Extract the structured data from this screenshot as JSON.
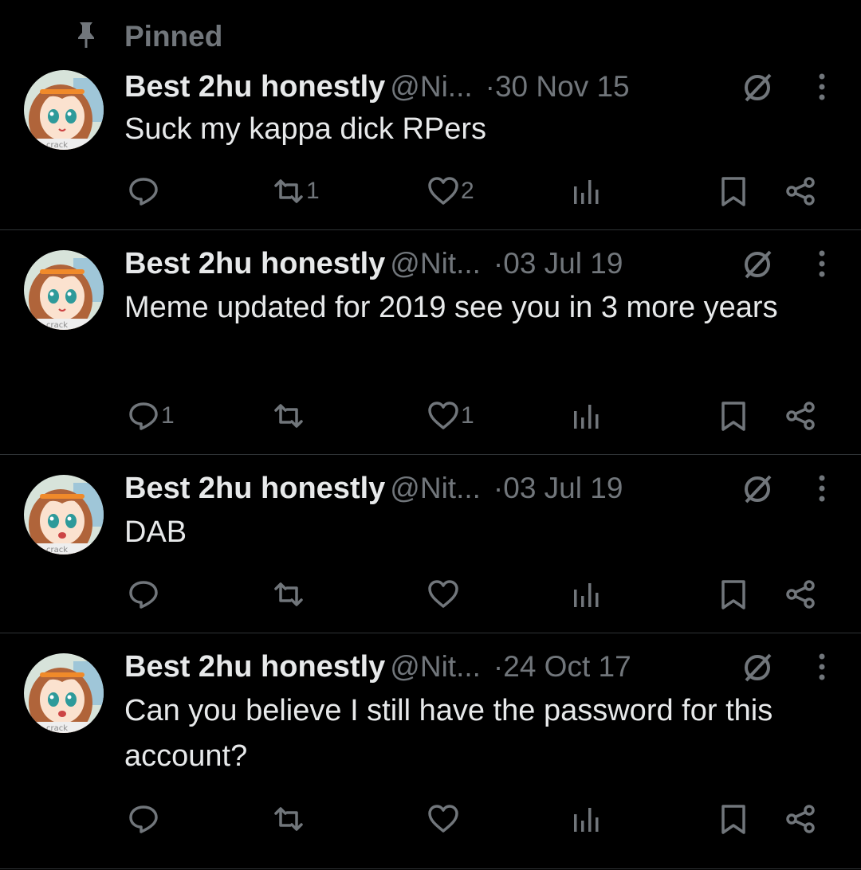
{
  "pinned_label": "Pinned",
  "colors": {
    "background": "#000000",
    "text_primary": "#e7e9ea",
    "text_secondary": "#71767b",
    "divider": "#2f3336"
  },
  "tweets": [
    {
      "display_name": "Best 2hu honestly",
      "handle": "@Ni...",
      "separator": "·",
      "date": "30 Nov 15",
      "text": "Suck my kappa dick RPers",
      "replies": "",
      "retweets": "1",
      "likes": "2"
    },
    {
      "display_name": "Best 2hu honestly",
      "handle": "@Nit...",
      "separator": "·",
      "date": "03 Jul 19",
      "text": "Meme updated for 2019 see you in 3 more years",
      "replies": "1",
      "retweets": "",
      "likes": "1"
    },
    {
      "display_name": "Best 2hu honestly",
      "handle": "@Nit...",
      "separator": "·",
      "date": "03 Jul 19",
      "text": "DAB",
      "replies": "",
      "retweets": "",
      "likes": ""
    },
    {
      "display_name": "Best 2hu honestly",
      "handle": "@Nit...",
      "separator": "·",
      "date": "24 Oct 17",
      "text": "Can you believe I still have the password for this account?",
      "replies": "",
      "retweets": "",
      "likes": ""
    }
  ],
  "icons": {
    "pin": "pin-icon",
    "reply": "reply-icon",
    "retweet": "retweet-icon",
    "like": "heart-icon",
    "views": "views-icon",
    "bookmark": "bookmark-icon",
    "share": "share-icon",
    "more": "more-icon",
    "restricted": "ban-icon"
  }
}
